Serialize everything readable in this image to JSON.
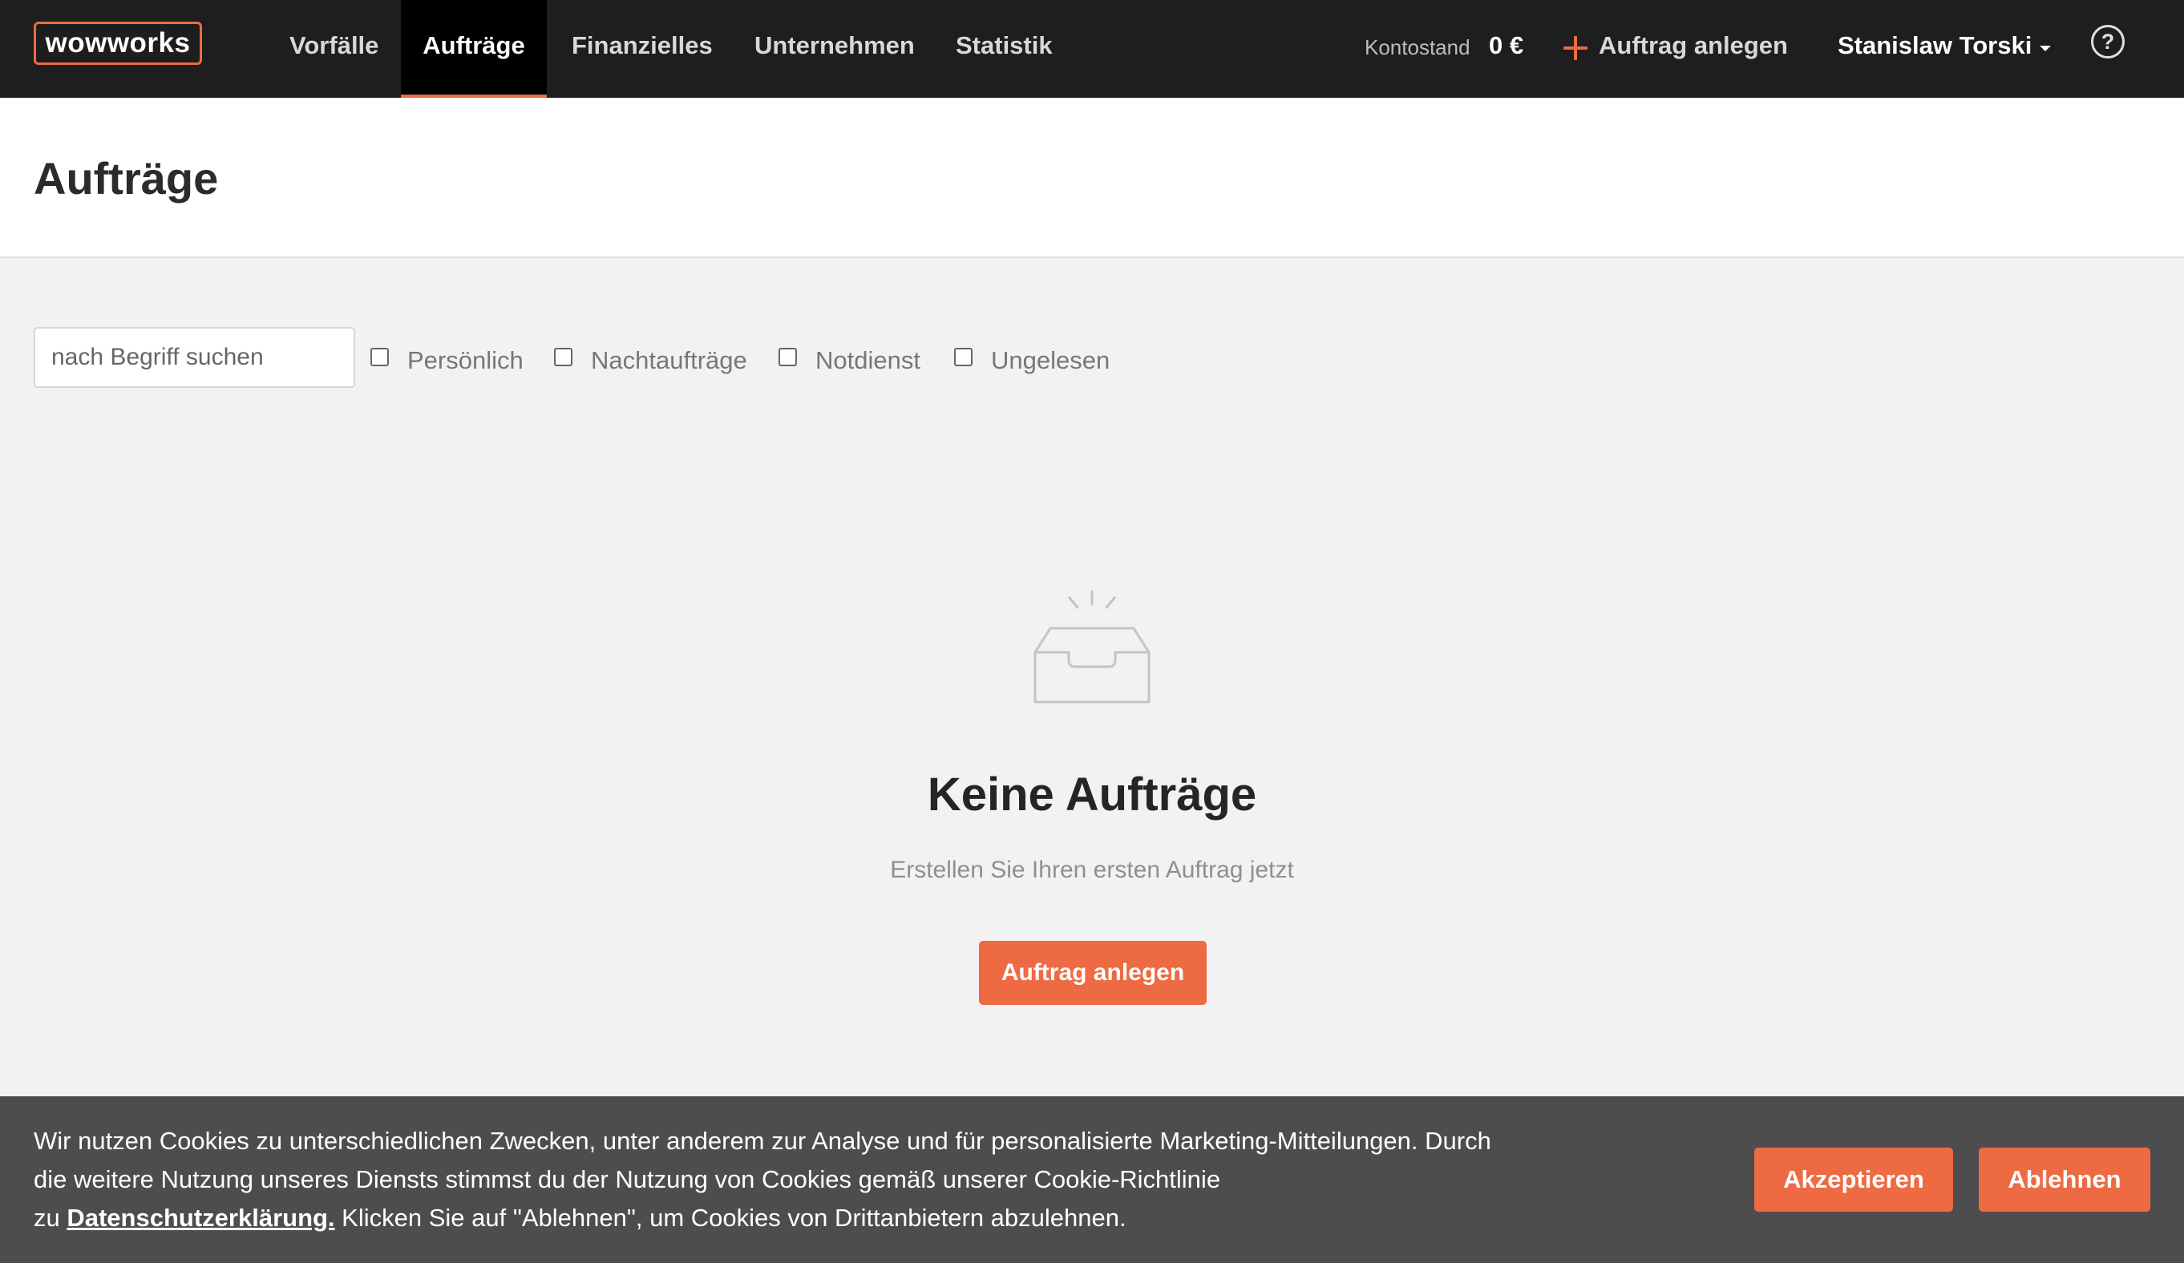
{
  "brand": {
    "logo_text": "wowworks",
    "accent_color": "#ee6a43"
  },
  "nav": {
    "items": [
      {
        "label": "Vorfälle",
        "active": false
      },
      {
        "label": "Aufträge",
        "active": true
      },
      {
        "label": "Finanzielles",
        "active": false
      },
      {
        "label": "Unternehmen",
        "active": false
      },
      {
        "label": "Statistik",
        "active": false
      }
    ],
    "balance_label": "Kontostand",
    "balance_value": "0 €",
    "create_label": "Auftrag anlegen",
    "user_name": "Stanislaw Torski",
    "help_icon": "help-circle-icon",
    "help_symbol": "?"
  },
  "page": {
    "title": "Aufträge"
  },
  "filters": {
    "search_placeholder": "nach Begriff suchen",
    "checkboxes": [
      {
        "label": "Persönlich",
        "checked": false
      },
      {
        "label": "Nachtaufträge",
        "checked": false
      },
      {
        "label": "Notdienst",
        "checked": false
      },
      {
        "label": "Ungelesen",
        "checked": false
      }
    ]
  },
  "empty_state": {
    "icon": "empty-inbox-icon",
    "title": "Keine Aufträge",
    "subtitle": "Erstellen Sie Ihren ersten Auftrag jetzt",
    "button_label": "Auftrag anlegen"
  },
  "cookie_banner": {
    "line1": "Wir nutzen Cookies zu unterschiedlichen Zwecken, unter anderem zur Analyse und für personalisierte Marketing-Mitteilungen. Durch",
    "line2": "die weitere Nutzung unseres Diensts stimmst du der Nutzung von Cookies gemäß unserer Cookie-Richtlinie",
    "line3_prefix": "zu ",
    "link_text": "Datenschutzerklärung.",
    "line3_suffix": " Klicken Sie auf \"Ablehnen\", um Cookies von Drittanbietern abzulehnen.",
    "accept_label": "Akzeptieren",
    "decline_label": "Ablehnen"
  }
}
